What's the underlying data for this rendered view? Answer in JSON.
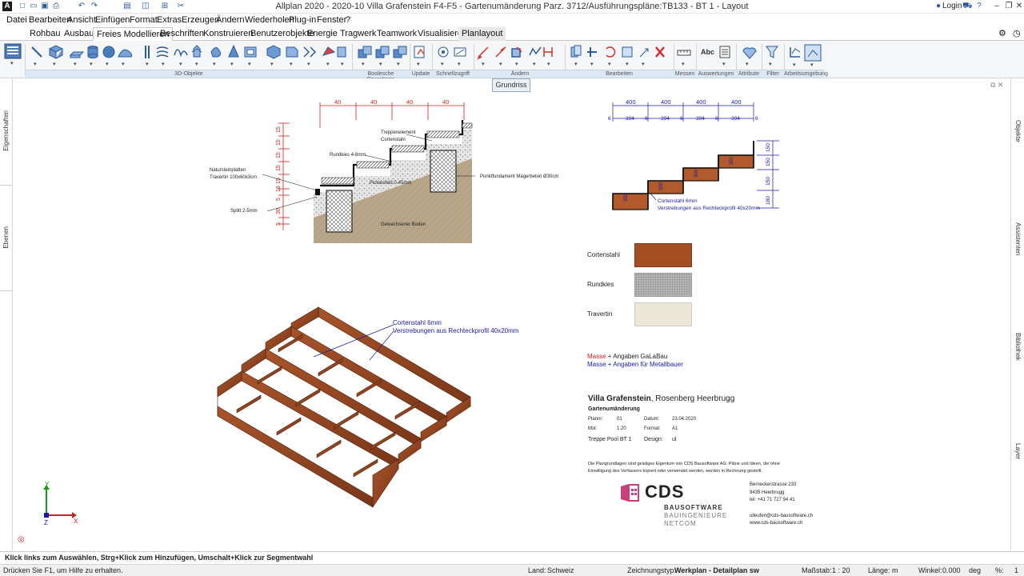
{
  "window": {
    "title": "Allplan 2020 - 2020-10 Villa Grafenstein F4-F5 - Gartenumänderung Parz. 3712/Ausführungspläne:TB133 - BT 1 - Layout",
    "login": "Login"
  },
  "menu": [
    "Datei",
    "Bearbeiten",
    "Ansicht",
    "Einfügen",
    "Format",
    "Extras",
    "Erzeugen",
    "Ändern",
    "Wiederholen",
    "Plug-in",
    "Fenster",
    "?"
  ],
  "tabs": [
    "Rohbau",
    "Ausbau",
    "Freies Modellieren",
    "Beschriften",
    "Konstruieren",
    "Benutzerobjekte",
    "Energie",
    "Tragwerk",
    "Teamwork",
    "Visualisieren",
    "Planlayout"
  ],
  "active_tab": "Freies Modellieren",
  "ribbon_groups": [
    "3D-Objekte",
    "Boolesche Operatoren",
    "Update",
    "Schnellzugriff",
    "Ändern",
    "Bearbeiten",
    "Messen",
    "Auswertungen",
    "Attribute",
    "Filter",
    "Arbeitsumgebung"
  ],
  "ribbon_text_icon": "Abc",
  "left_panels": [
    "Eigenschaften",
    "Ebenen"
  ],
  "right_panels": [
    "Objekte",
    "Assistenten",
    "Bibliothek",
    "Layer"
  ],
  "view_label": "Grundriss",
  "section_drawing": {
    "dims_top": [
      "40",
      "40",
      "40",
      "40"
    ],
    "dims_left": [
      "15",
      "15",
      "15",
      "15",
      "15",
      "18",
      "5",
      "30",
      "5"
    ],
    "labels": [
      "Treppenelement",
      "Cortenstahl",
      "Rundkies 4-8mm",
      "Natursteinplatten",
      "Travertin 100x60x3cm",
      "Splitt 2-5mm",
      "Punktfundament Magerbeton Ø30cm",
      "Pickiesfeld 0-45mm",
      "Gewachsener Boden"
    ]
  },
  "stair_detail": {
    "dims_top": [
      "400",
      "400",
      "400",
      "400"
    ],
    "dims_sub": [
      "6",
      "394",
      "6",
      "394",
      "6",
      "394",
      "6",
      "394",
      "6"
    ],
    "dims_right": [
      "150",
      "150",
      "150",
      "180"
    ],
    "riser_labels": [
      "350",
      "300",
      "300",
      "350"
    ],
    "note1": "Cortenstahl 6mm",
    "note2": "Verstrebungen aus Rechteckprofil 40x20mm"
  },
  "iso_note": {
    "l1": "Cortenstahl 6mm",
    "l2": "Verstrebungen aus Rechteckprofil 40x20mm"
  },
  "materials": [
    {
      "name": "Cortenstahl",
      "color": "#a54e24"
    },
    {
      "name": "Rundkies",
      "color": "#b8b8b8"
    },
    {
      "name": "Travertin",
      "color": "#ece6d8"
    }
  ],
  "legend": {
    "masse": "Masse",
    "plus1": " + Angaben GaLaBau",
    "masse2": "Masse + Angaben für Metallbauer"
  },
  "titleblock": {
    "project_bold": "Villa Grafenstein",
    "project_rest": ", Rosenberg Heerbrugg",
    "subtitle": "Gartenumänderung",
    "planno_l": "Plannr:",
    "planno_v": "01",
    "date_l": "Datum:",
    "date_v": "23.04.2020",
    "scale_l": "Mst:",
    "scale_v": "1:20",
    "format_l": "Format:",
    "format_v": "A1",
    "plan_name": "Treppe Pool BT 1",
    "design_l": "Design:",
    "design_v": "ul",
    "disclaimer1": "Die Plangrundlagen sind geistiges Eigentum von CDS Bausoftware AG. Pläne und Ideen, die ohne",
    "disclaimer2": "Einwilligung des Verfassers kopiert oder verwendet werden, werden in Rechnung gestellt.",
    "logo": "CDS",
    "logo_line1": "BAUSOFTWARE",
    "logo_line2": "BAUINGENIEURE",
    "logo_line3": "NETCOM",
    "addr1": "Bernecker­strasse 233",
    "addr2": "9435 Heerbrugg",
    "addr3": "tel: +41 71 727 94 41",
    "mail": "ulleufen@cds-bausoftware.ch",
    "web": "www.cds-bausoftware.ch"
  },
  "axis": {
    "x": "X",
    "y": "Y",
    "z": "Z"
  },
  "hint": "Klick links zum Auswählen, Strg+Klick zum Hinzufügen, Umschalt+Klick zur Segmentwahl",
  "status": {
    "help": "Drücken Sie F1, um Hilfe zu erhalten.",
    "land_l": "Land:",
    "land_v": "Schweiz",
    "ztyp_l": "Zeichnungstyp:",
    "ztyp_v": "Werkplan - Detailplan sw",
    "mst_l": "Maßstab:",
    "mst_v": "1 : 20",
    "len_l": "Länge:",
    "len_v": "m",
    "angle_l": "Winkel:",
    "angle_v": "0.000",
    "angle_u": "deg",
    "pct_l": "%:",
    "pct_v": "1"
  }
}
